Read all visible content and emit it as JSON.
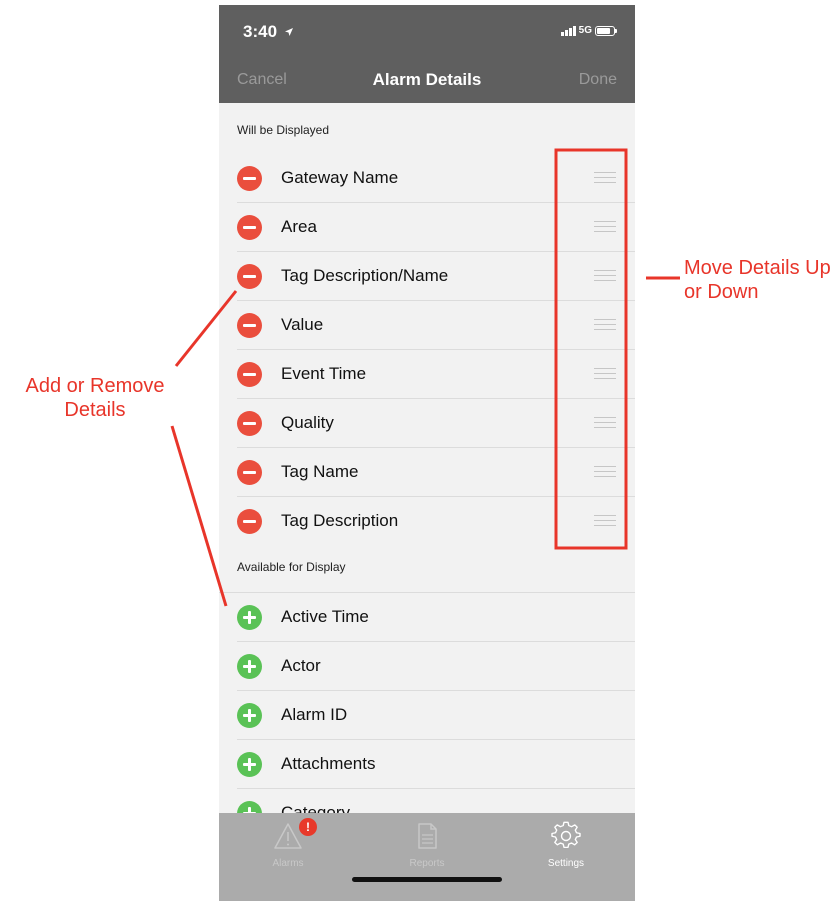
{
  "status_bar": {
    "time": "3:40",
    "network": "5G",
    "location_arrow": "location-arrow-icon"
  },
  "nav": {
    "cancel_label": "Cancel",
    "title": "Alarm Details",
    "done_label": "Done"
  },
  "displayed": {
    "header": "Will be Displayed",
    "items": [
      {
        "label": "Gateway Name"
      },
      {
        "label": "Area"
      },
      {
        "label": "Tag Description/Name"
      },
      {
        "label": "Value"
      },
      {
        "label": "Event Time"
      },
      {
        "label": "Quality"
      },
      {
        "label": "Tag Name"
      },
      {
        "label": "Tag Description"
      }
    ]
  },
  "available": {
    "header": "Available for Display",
    "items": [
      {
        "label": "Active Time"
      },
      {
        "label": "Actor"
      },
      {
        "label": "Alarm ID"
      },
      {
        "label": "Attachments"
      },
      {
        "label": "Category"
      }
    ]
  },
  "tabs": [
    {
      "label": "Alarms",
      "icon": "warning-triangle-icon",
      "badge": "!"
    },
    {
      "label": "Reports",
      "icon": "document-icon"
    },
    {
      "label": "Settings",
      "icon": "gear-icon",
      "active": true
    }
  ],
  "annotations": {
    "add_remove": "Add or Remove Details",
    "move": "Move Details Up or Down"
  },
  "colors": {
    "remove": "#ea4e3d",
    "add": "#5ac256",
    "annotation": "#e8352a",
    "nav_background": "#5f5f5f",
    "tab_background": "#ababab"
  }
}
